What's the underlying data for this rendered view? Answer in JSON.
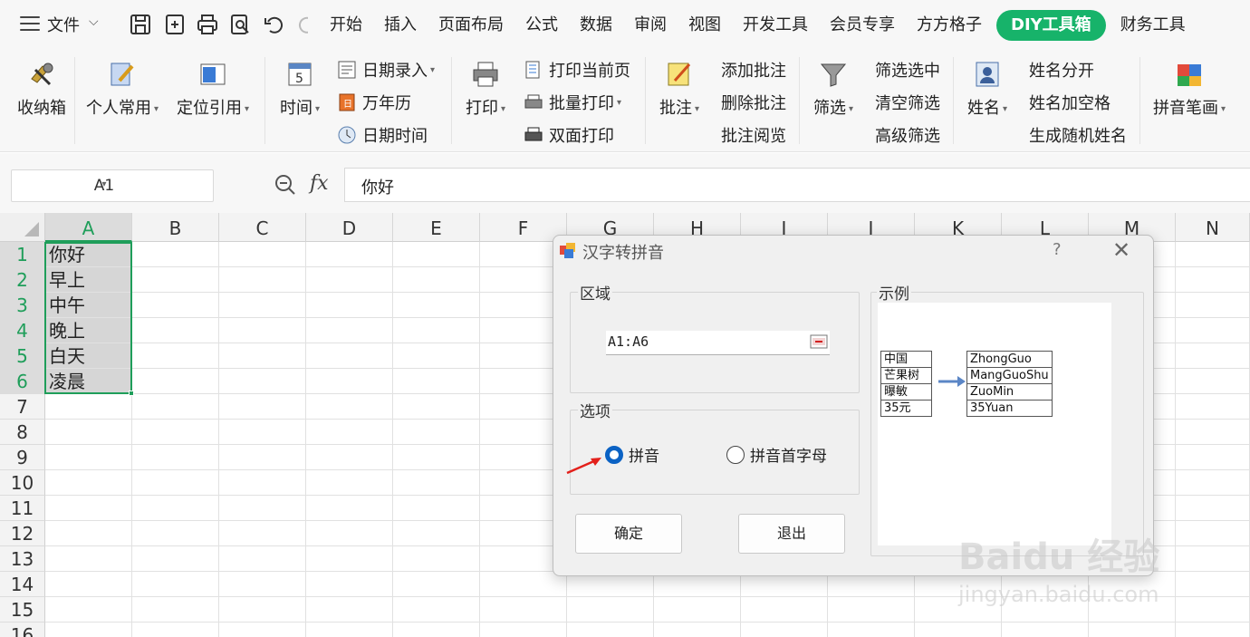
{
  "menubar": {
    "file_label": "文件",
    "tabs": [
      {
        "label": "开始"
      },
      {
        "label": "插入"
      },
      {
        "label": "页面布局"
      },
      {
        "label": "公式"
      },
      {
        "label": "数据"
      },
      {
        "label": "审阅"
      },
      {
        "label": "视图"
      },
      {
        "label": "开发工具"
      },
      {
        "label": "会员专享"
      },
      {
        "label": "方方格子"
      },
      {
        "label": "DIY工具箱",
        "active": true
      },
      {
        "label": "财务工具"
      }
    ],
    "accent_color": "#17b36a"
  },
  "ribbon": {
    "collect_box": "收纳箱",
    "personal_common": "个人常用",
    "locate_ref": "定位引用",
    "time": "时间",
    "date_entry": "日期录入",
    "perpetual_calendar": "万年历",
    "date_time": "日期时间",
    "print": "打印",
    "print_current_page": "打印当前页",
    "batch_print": "批量打印",
    "duplex_print": "双面打印",
    "comment": "批注",
    "add_comment": "添加批注",
    "delete_comment": "删除批注",
    "comment_read": "批注阅览",
    "filter": "筛选",
    "filter_selected": "筛选选中",
    "clear_filter": "清空筛选",
    "advanced_filter": "高级筛选",
    "name": "姓名",
    "name_split": "姓名分开",
    "name_add_space": "姓名加空格",
    "gen_random_name": "生成随机姓名",
    "pinyin_strokes": "拼音笔画"
  },
  "formula_bar": {
    "name_box": "A1",
    "fx": "fx",
    "value": "你好"
  },
  "sheet": {
    "columns": [
      "A",
      "B",
      "C",
      "D",
      "E",
      "F",
      "G",
      "H",
      "I",
      "J",
      "K",
      "L",
      "M",
      "N"
    ],
    "rows": [
      "1",
      "2",
      "3",
      "4",
      "5",
      "6",
      "7",
      "8",
      "9",
      "10",
      "11",
      "12",
      "13",
      "14",
      "15",
      "16"
    ],
    "col_a_values": [
      "你好",
      "早上",
      "中午",
      "晚上",
      "白天",
      "凌晨"
    ],
    "selection_color": "#1f9e5a"
  },
  "dialog": {
    "title": "汉字转拼音",
    "help": "?",
    "close": "✕",
    "region_label": "区域",
    "range_value": "A1:A6",
    "options_label": "选项",
    "option_pinyin": "拼音",
    "option_initials": "拼音首字母",
    "selected_option": "拼音",
    "ok_button": "确定",
    "exit_button": "退出",
    "example_label": "示例",
    "example_left": [
      "中国",
      "芒果树",
      "曝敏",
      "35元"
    ],
    "example_right": [
      "ZhongGuo",
      "MangGuoShu",
      "ZuoMin",
      "35Yuan"
    ]
  },
  "watermark": {
    "main": "Baidu 经验",
    "sub": "jingyan.baidu.com"
  }
}
